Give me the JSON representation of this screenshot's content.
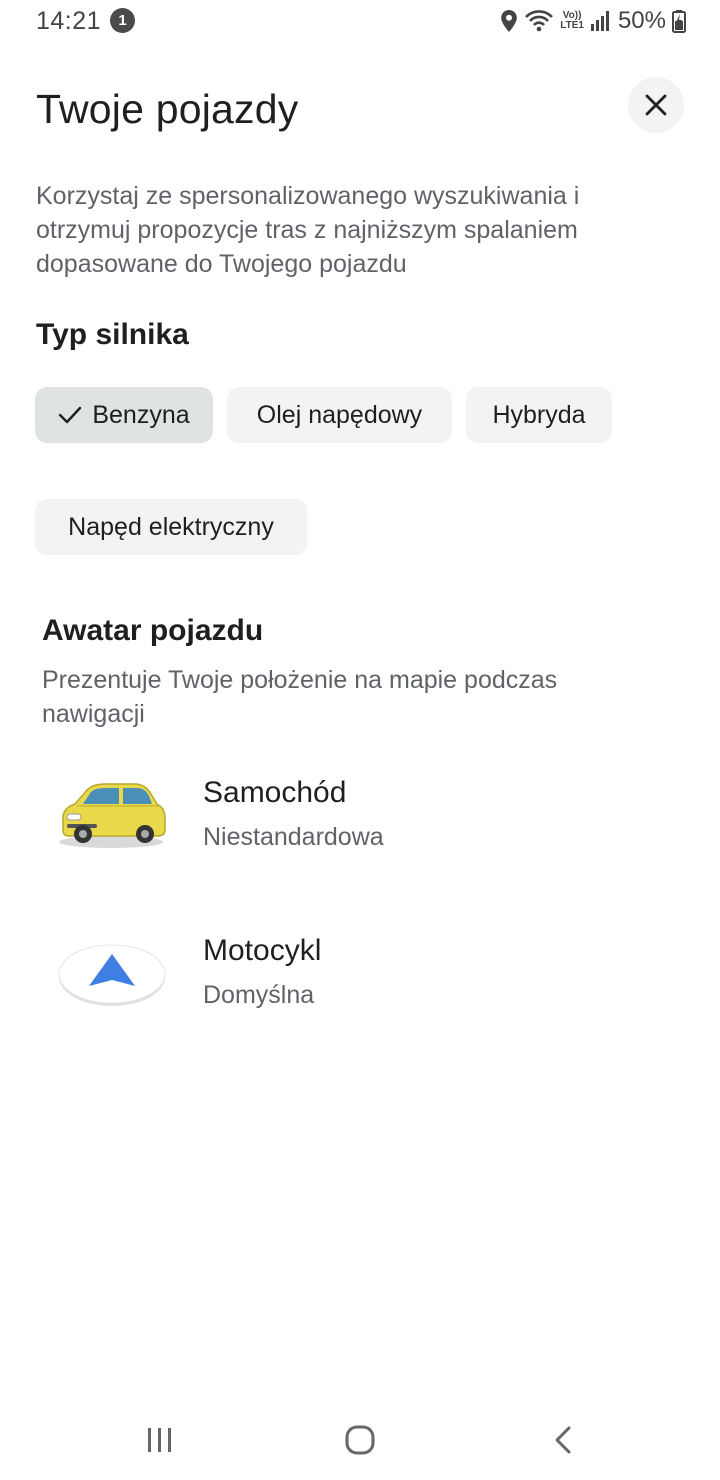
{
  "status_bar": {
    "time": "14:21",
    "notification_count": "1",
    "network": "LTE1",
    "battery": "50%"
  },
  "header": {
    "title": "Twoje pojazdy",
    "close_icon": "close-icon"
  },
  "description": "Korzystaj ze spersonalizowanego wyszukiwania i otrzymuj propozycje tras z najniższym spalaniem dopasowane do Twojego pojazdu",
  "engine": {
    "title": "Typ silnika",
    "options": [
      {
        "label": "Benzyna",
        "selected": true
      },
      {
        "label": "Olej napędowy",
        "selected": false
      },
      {
        "label": "Hybryda",
        "selected": false
      },
      {
        "label": "Napęd elektryczny",
        "selected": false
      }
    ]
  },
  "avatar": {
    "title": "Awatar pojazdu",
    "description": "Prezentuje Twoje położenie na mapie podczas nawigacji",
    "items": [
      {
        "name": "Samochód",
        "subtitle": "Niestandardowa",
        "icon": "yellow-car-icon"
      },
      {
        "name": "Motocykl",
        "subtitle": "Domyślna",
        "icon": "navigation-arrow-icon"
      }
    ]
  },
  "nav_bar": {
    "recent": "recent-apps-icon",
    "home": "home-icon",
    "back": "back-icon"
  },
  "colors": {
    "chip_bg": "#f1f3f4",
    "chip_selected_bg": "#dfe3e3",
    "arrow_blue": "#3f7fe3",
    "car_yellow": "#e8d84a"
  }
}
